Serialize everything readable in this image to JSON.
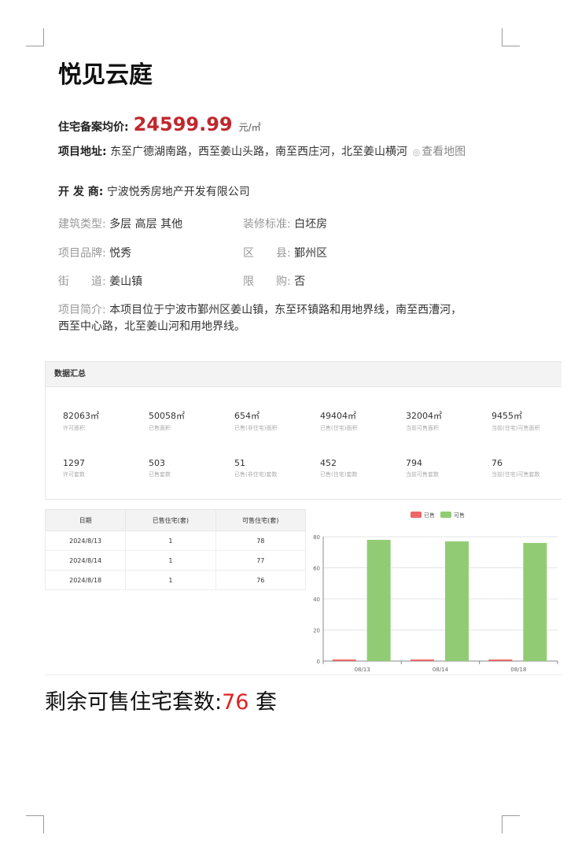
{
  "project": {
    "name": "悦见云庭",
    "price_label": "住宅备案均价:",
    "price_value": "24599.99",
    "price_unit": "元/㎡",
    "address_label": "项目地址:",
    "address_text": "东至广德湖南路，西至姜山头路，南至西庄河，北至姜山横河",
    "map_link": "查看地图",
    "developer_label": "开 发 商:",
    "developer_value": "宁波悦秀房地产开发有限公司",
    "attrs": {
      "building_type_label": "建筑类型:",
      "building_type_value": "多层 高层 其他",
      "decoration_label": "装修标准:",
      "decoration_value": "白坯房",
      "brand_label": "项目品牌:",
      "brand_value": "悦秀",
      "district_label": "区　　县:",
      "district_value": "鄞州区",
      "street_label": "街　　道:",
      "street_value": "姜山镇",
      "limit_label": "限　　购:",
      "limit_value": "否"
    },
    "intro_label": "项目简介:",
    "intro_text": "本项目位于宁波市鄞州区姜山镇，东至环镇路和用地界线，南至西漕河，西至中心路，北至姜山河和用地界线。"
  },
  "summary": {
    "title": "数据汇总",
    "stats": [
      {
        "value": "82063㎡",
        "label": "许可面积"
      },
      {
        "value": "50058㎡",
        "label": "已售面积"
      },
      {
        "value": "654㎡",
        "label": "已售(非住宅)面积"
      },
      {
        "value": "49404㎡",
        "label": "已售(住宅)面积"
      },
      {
        "value": "32004㎡",
        "label": "当前可售面积"
      },
      {
        "value": "9455㎡",
        "label": "当前(住宅)可售面积"
      },
      {
        "value": "1297",
        "label": "许可套数"
      },
      {
        "value": "503",
        "label": "已售套数"
      },
      {
        "value": "51",
        "label": "已售(非住宅)套数"
      },
      {
        "value": "452",
        "label": "已售(住宅)套数"
      },
      {
        "value": "794",
        "label": "当前可售套数"
      },
      {
        "value": "76",
        "label": "当前(住宅)可售套数"
      }
    ]
  },
  "daily_table": {
    "headers": [
      "日期",
      "已售住宅(套)",
      "可售住宅(套)"
    ],
    "rows": [
      [
        "2024/8/13",
        "1",
        "78"
      ],
      [
        "2024/8/14",
        "1",
        "77"
      ],
      [
        "2024/8/18",
        "1",
        "76"
      ]
    ]
  },
  "chart_data": {
    "type": "bar",
    "categories": [
      "08/13",
      "08/14",
      "08/18"
    ],
    "series": [
      {
        "name": "已售",
        "values": [
          1,
          1,
          1
        ],
        "color": "#ee6666"
      },
      {
        "name": "可售",
        "values": [
          78,
          77,
          76
        ],
        "color": "#91cc75"
      }
    ],
    "ylim": [
      0,
      80
    ],
    "yticks": [
      0,
      20,
      40,
      60,
      80
    ],
    "grid": true,
    "legend": "top-center"
  },
  "footer": {
    "prefix": "剩余可售住宅套数:",
    "count": "76",
    "suffix": " 套"
  }
}
